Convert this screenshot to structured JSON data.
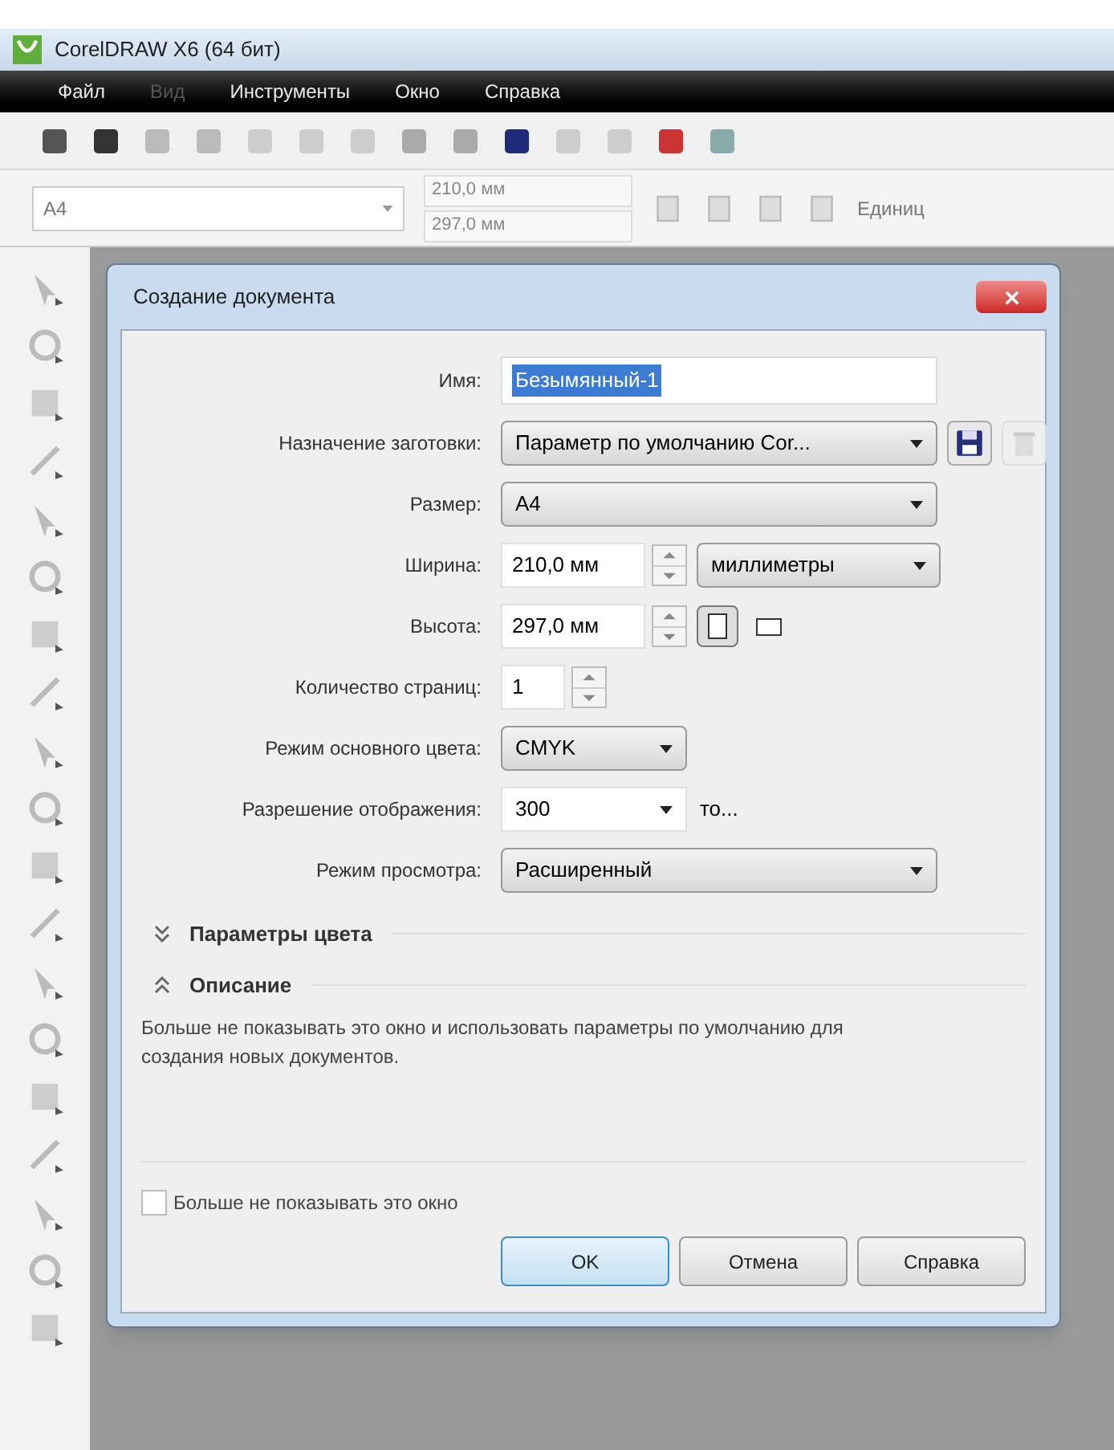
{
  "window": {
    "title": "CorelDRAW X6 (64 бит)"
  },
  "menu": [
    {
      "label": "Файл",
      "disabled": false
    },
    {
      "label": "Вид",
      "disabled": true
    },
    {
      "label": "Инструменты",
      "disabled": false
    },
    {
      "label": "Окно",
      "disabled": false
    },
    {
      "label": "Справка",
      "disabled": false
    }
  ],
  "property_bar": {
    "page_size": "A4",
    "width": "210,0 мм",
    "height": "297,0 мм",
    "units_label": "Единиц"
  },
  "dialog": {
    "title": "Создание документа",
    "fields": [
      {
        "kind": "text",
        "label": "Имя:",
        "value": "Безымянный-1"
      },
      {
        "kind": "preset",
        "label": "Назначение заготовки:",
        "value": "Параметр по умолчанию Cor..."
      },
      {
        "kind": "select",
        "label": "Размер:",
        "value": "A4"
      },
      {
        "kind": "width",
        "label": "Ширина:",
        "value": "210,0 мм",
        "units": "миллиметры"
      },
      {
        "kind": "height",
        "label": "Высота:",
        "value": "297,0 мм",
        "orientations": [
          {
            "kind": "portrait",
            "selected": true
          },
          {
            "kind": "landscape",
            "selected": false
          }
        ]
      },
      {
        "kind": "spin",
        "label": "Количество страниц:",
        "value": "1"
      },
      {
        "kind": "small_select",
        "label": "Режим основного цвета:",
        "value": "CMYK"
      },
      {
        "kind": "resolution",
        "label": "Разрешение отображения:",
        "value": "300",
        "suffix": "то..."
      },
      {
        "kind": "select",
        "label": "Режим просмотра:",
        "value": "Расширенный"
      }
    ],
    "sections": [
      {
        "title": "Параметры цвета",
        "expanded": false
      },
      {
        "title": "Описание",
        "expanded": true
      }
    ],
    "description": "Больше не показывать это окно и использовать параметры по умолчанию для создания новых документов.",
    "dont_show": {
      "label": "Больше не показывать это окно",
      "checked": false
    },
    "buttons": [
      {
        "label": "OK",
        "default": true
      },
      {
        "label": "Отмена",
        "default": false
      },
      {
        "label": "Справка",
        "default": false
      }
    ]
  }
}
